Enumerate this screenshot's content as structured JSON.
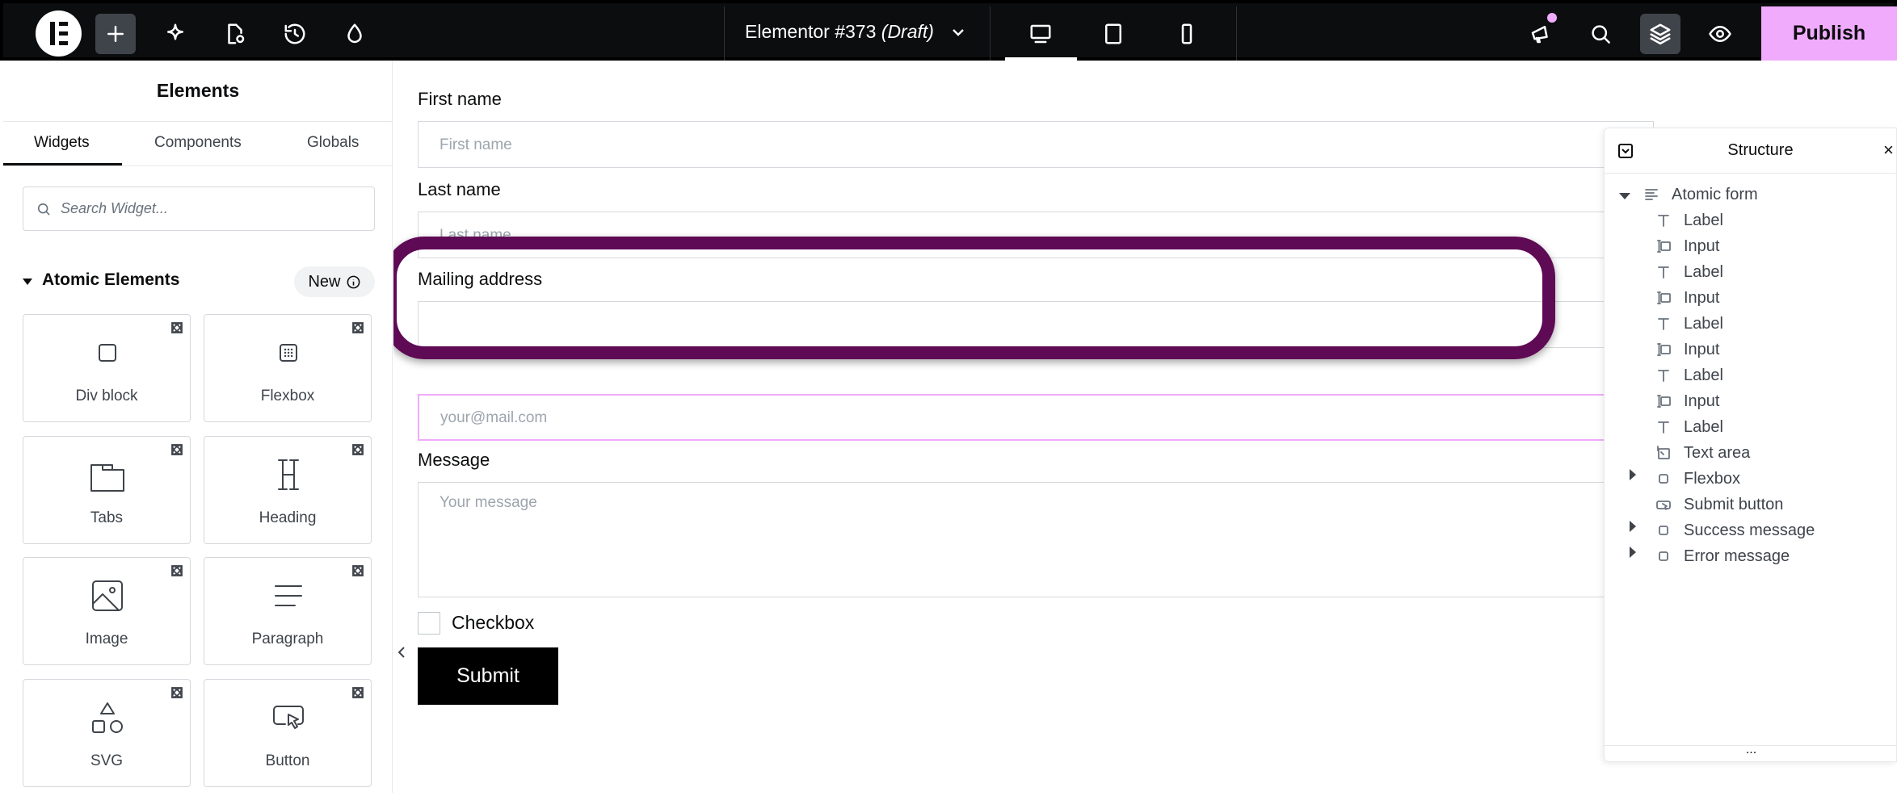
{
  "topbar": {
    "doc_title": "Elementor #373",
    "doc_status": "(Draft)",
    "publish_label": "Publish",
    "colors": {
      "bar": "#0c0d0e",
      "publish": "#f0abfc",
      "notification": "#f0abfc"
    }
  },
  "panel": {
    "title": "Elements",
    "tabs": [
      "Widgets",
      "Components",
      "Globals"
    ],
    "search_placeholder": "Search Widget...",
    "category": "Atomic Elements",
    "new_badge": "New",
    "widgets": [
      "Div block",
      "Flexbox",
      "Tabs",
      "Heading",
      "Image",
      "Paragraph",
      "SVG",
      "Button"
    ]
  },
  "form": {
    "first_name_label": "First name",
    "first_name_placeholder": "First name",
    "last_name_label": "Last name",
    "last_name_placeholder": "Last name",
    "mailing_label": "Mailing address",
    "email_placeholder": "your@mail.com",
    "message_label": "Message",
    "message_placeholder": "Your message",
    "checkbox_label": "Checkbox",
    "submit_label": "Submit",
    "highlight_color": "#5e0a55"
  },
  "structure": {
    "title": "Structure",
    "root": "Atomic form",
    "items": [
      "Label",
      "Input",
      "Label",
      "Input",
      "Label",
      "Input",
      "Label",
      "Input",
      "Label",
      "Text area",
      "Flexbox",
      "Submit button",
      "Success message",
      "Error message"
    ],
    "footer": "..."
  }
}
